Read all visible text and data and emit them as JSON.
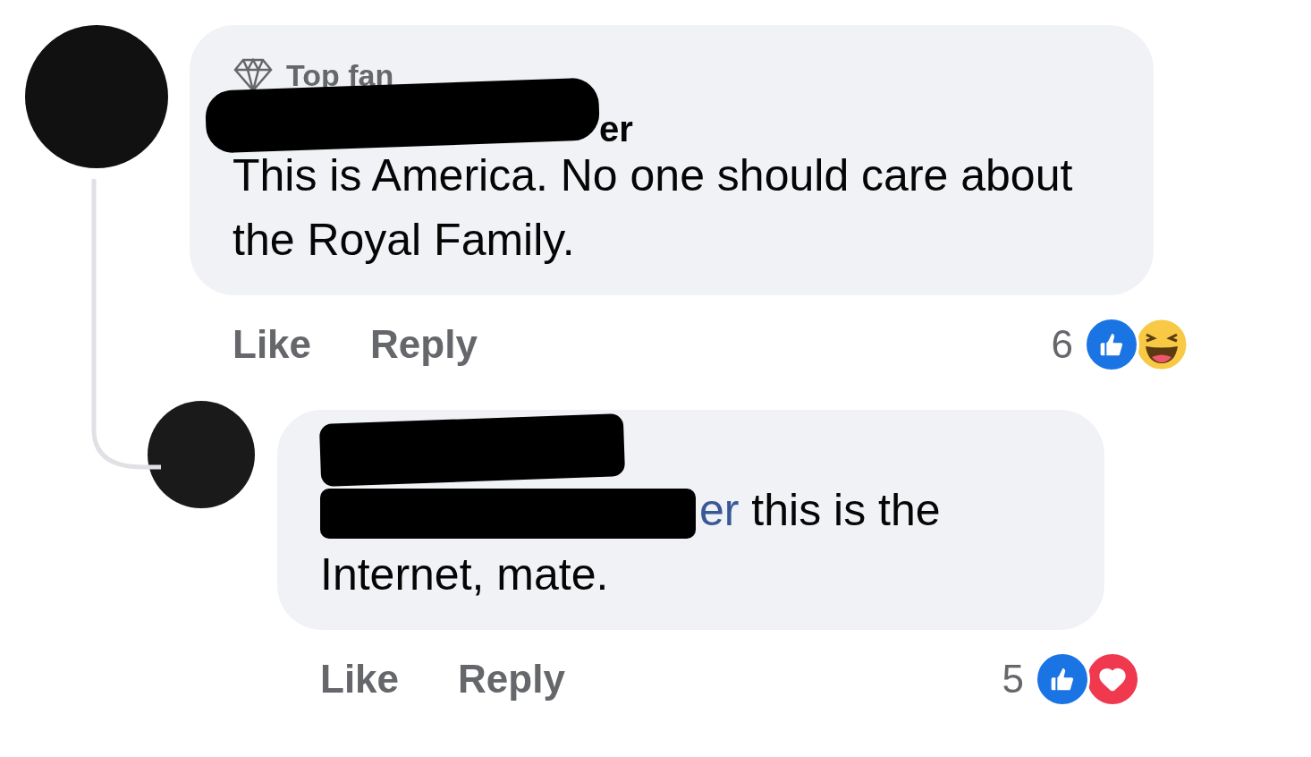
{
  "comments": [
    {
      "badge": "Top fan",
      "author_fragment": "er",
      "body": [
        {
          "kind": "plain",
          "text": "This is America. No one should care about the Royal Family."
        }
      ],
      "actions": [
        "Like",
        "Reply"
      ],
      "reaction_count": "6",
      "reactions": [
        {
          "kind": "like"
        },
        {
          "kind": "haha"
        }
      ]
    },
    {
      "body": [
        {
          "kind": "mention",
          "text": "er"
        },
        {
          "kind": "plain",
          "text": " this is the Internet, mate."
        }
      ],
      "actions": [
        "Like",
        "Reply"
      ],
      "reaction_count": "5",
      "reactions": [
        {
          "kind": "like"
        },
        {
          "kind": "love"
        }
      ]
    }
  ]
}
